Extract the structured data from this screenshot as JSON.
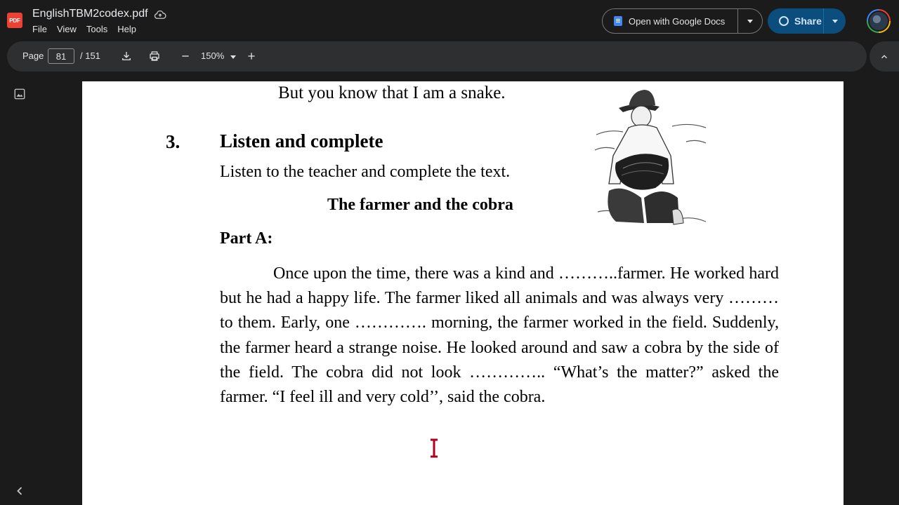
{
  "app": {
    "file_title": "EnglishTBM2codex.pdf",
    "logo_text": "PDF",
    "menu": [
      "File",
      "View",
      "Tools",
      "Help"
    ],
    "open_with_label": "Open with Google Docs",
    "share_label": "Share"
  },
  "toolbar": {
    "page_label": "Page",
    "current_page": "81",
    "total_pages": "/ 151",
    "zoom": "150%"
  },
  "icons": {
    "logo": "pdf-logo-icon",
    "cloud": "cloud-save-icon",
    "download": "download-icon",
    "print": "print-icon",
    "zoom_out": "minus-icon",
    "zoom_in": "plus-icon",
    "thumbnails": "image-icon",
    "collapse": "chevron-up-icon",
    "expand": "chevron-left-icon"
  },
  "colors": {
    "share_bg": "#0b4e7d",
    "toolbar_bg": "#2e2f31",
    "pdf_badge": "#ea4335"
  },
  "pdf": {
    "line_top": "But you know that I am a snake.",
    "section_number": "3.",
    "section_title": "Listen and complete",
    "instruction": "Listen to the teacher and complete the text.",
    "story_title": "The farmer and the cobra",
    "part_label": "Part A:",
    "paragraph": "Once upon the time, there was a kind and ………..farmer. He worked hard but he had a happy life. The farmer liked all animals and was always very ……… to them. Early, one …………. morning, the farmer worked in the field. Suddenly, the farmer heard a strange noise. He looked around and saw a cobra by the side of the field. The cobra did not look ………….. “What’s the matter?” asked the farmer. “I feel ill and very cold’’, said the cobra."
  }
}
